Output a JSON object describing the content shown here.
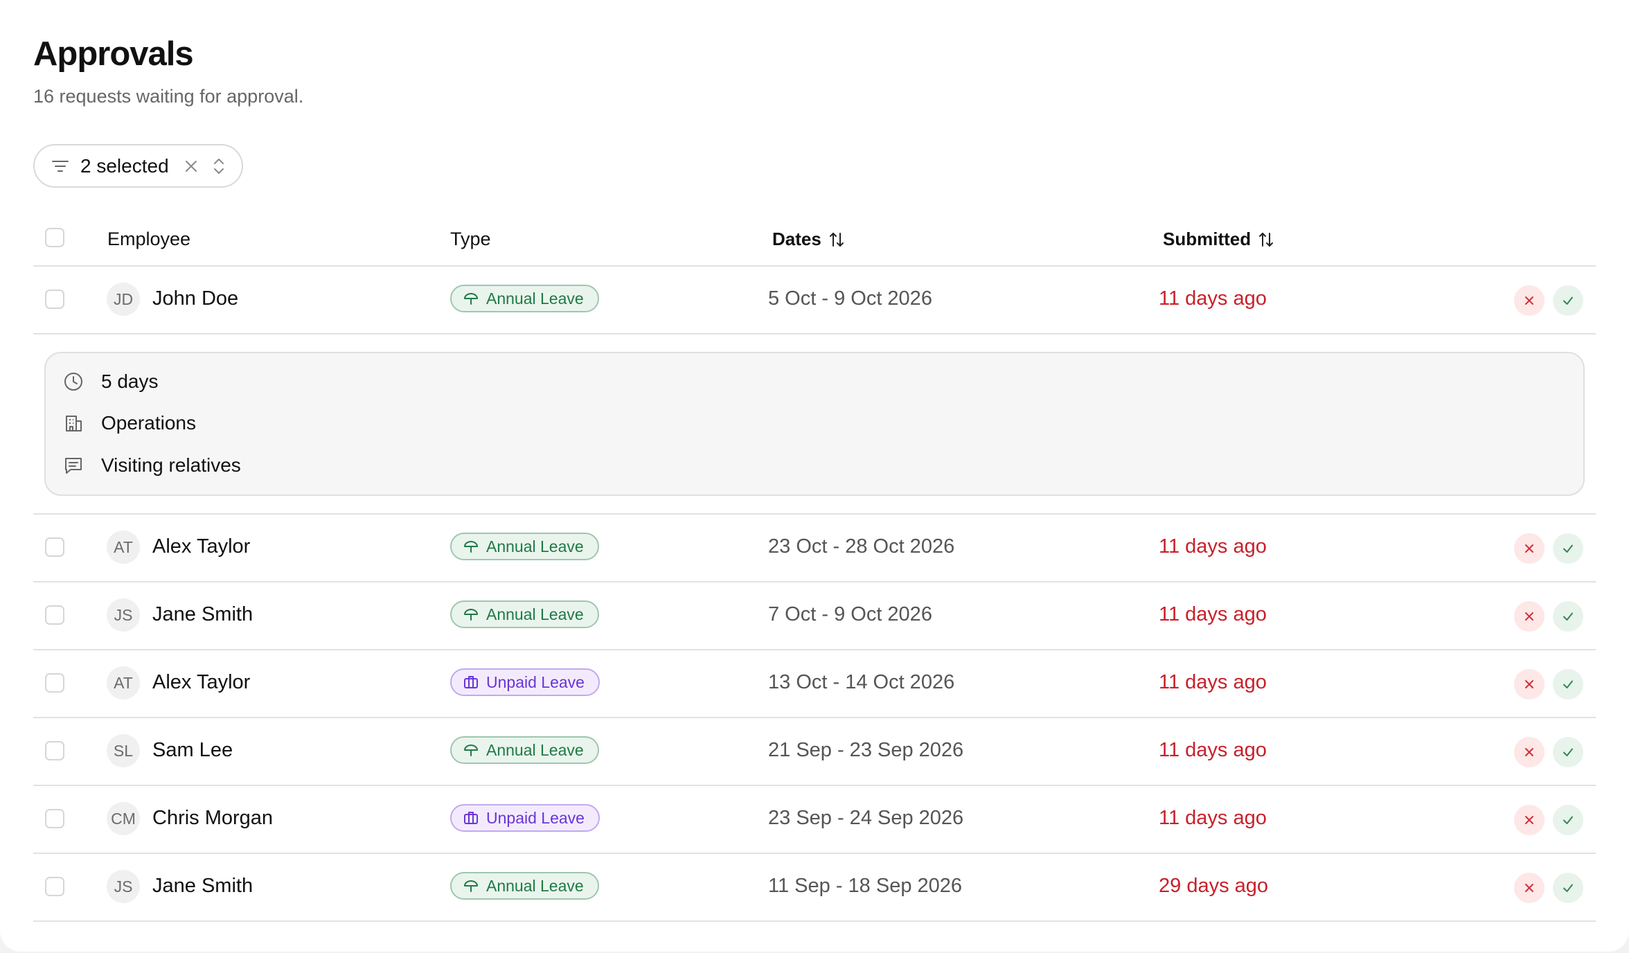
{
  "header": {
    "title": "Approvals",
    "subtitle": "16 requests waiting for approval."
  },
  "filter": {
    "label": "2 selected",
    "icon": "filter-lines-icon",
    "clear_icon": "close-icon",
    "toggle_icon": "chevron-up-down-icon"
  },
  "table": {
    "columns": {
      "employee": "Employee",
      "type": "Type",
      "dates": "Dates",
      "submitted": "Submitted"
    },
    "rows": [
      {
        "initials": "JD",
        "name": "John Doe",
        "type": "Annual Leave",
        "type_kind": "annual",
        "dates": "5 Oct - 9 Oct 2026",
        "submitted": "11 days ago"
      },
      {
        "initials": "AT",
        "name": "Alex Taylor",
        "type": "Annual Leave",
        "type_kind": "annual",
        "dates": "23 Oct - 28 Oct 2026",
        "submitted": "11 days ago"
      },
      {
        "initials": "JS",
        "name": "Jane Smith",
        "type": "Annual Leave",
        "type_kind": "annual",
        "dates": "7 Oct - 9 Oct 2026",
        "submitted": "11 days ago"
      },
      {
        "initials": "AT",
        "name": "Alex Taylor",
        "type": "Unpaid Leave",
        "type_kind": "unpaid",
        "dates": "13 Oct - 14 Oct 2026",
        "submitted": "11 days ago"
      },
      {
        "initials": "SL",
        "name": "Sam Lee",
        "type": "Annual Leave",
        "type_kind": "annual",
        "dates": "21 Sep - 23 Sep 2026",
        "submitted": "11 days ago"
      },
      {
        "initials": "CM",
        "name": "Chris Morgan",
        "type": "Unpaid Leave",
        "type_kind": "unpaid",
        "dates": "23 Sep - 24 Sep 2026",
        "submitted": "11 days ago"
      },
      {
        "initials": "JS",
        "name": "Jane Smith",
        "type": "Annual Leave",
        "type_kind": "annual",
        "dates": "11 Sep - 18 Sep 2026",
        "submitted": "29 days ago"
      }
    ],
    "expanded": {
      "duration": "5 days",
      "department": "Operations",
      "note": "Visiting relatives"
    }
  },
  "colors": {
    "annual_bg": "#e9f4ed",
    "annual_text": "#1f7a45",
    "unpaid_bg": "#f3ebfd",
    "unpaid_text": "#6a35d6",
    "submitted_text": "#c8202a",
    "reject_bg": "#fde7e7",
    "approve_bg": "#e8f3ec"
  }
}
